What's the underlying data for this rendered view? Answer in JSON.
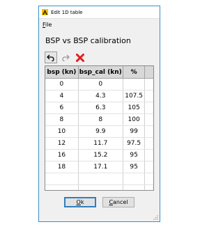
{
  "window": {
    "title": "Edit 1D table"
  },
  "menu": {
    "file_hot": "F",
    "file_rest": "ile"
  },
  "heading": "BSP vs BSP calibration",
  "toolbar": {
    "undo_icon": "undo-arrow",
    "redo_icon": "redo-arrow",
    "delete_icon": "red-x",
    "delete_color": "#e02020"
  },
  "table": {
    "headers": [
      "bsp (kn)",
      "bsp_cal (kn)",
      "%"
    ],
    "rows": [
      [
        "0",
        "0",
        ""
      ],
      [
        "4",
        "4.3",
        "107.5"
      ],
      [
        "6",
        "6.3",
        "105"
      ],
      [
        "8",
        "8",
        "100"
      ],
      [
        "10",
        "9.9",
        "99"
      ],
      [
        "12",
        "11.7",
        "97.5"
      ],
      [
        "16",
        "15.2",
        "95"
      ],
      [
        "18",
        "17.1",
        "95"
      ]
    ]
  },
  "buttons": {
    "ok_hot": "O",
    "ok_rest": "k",
    "cancel_hot": "C",
    "cancel_rest": "ancel"
  }
}
